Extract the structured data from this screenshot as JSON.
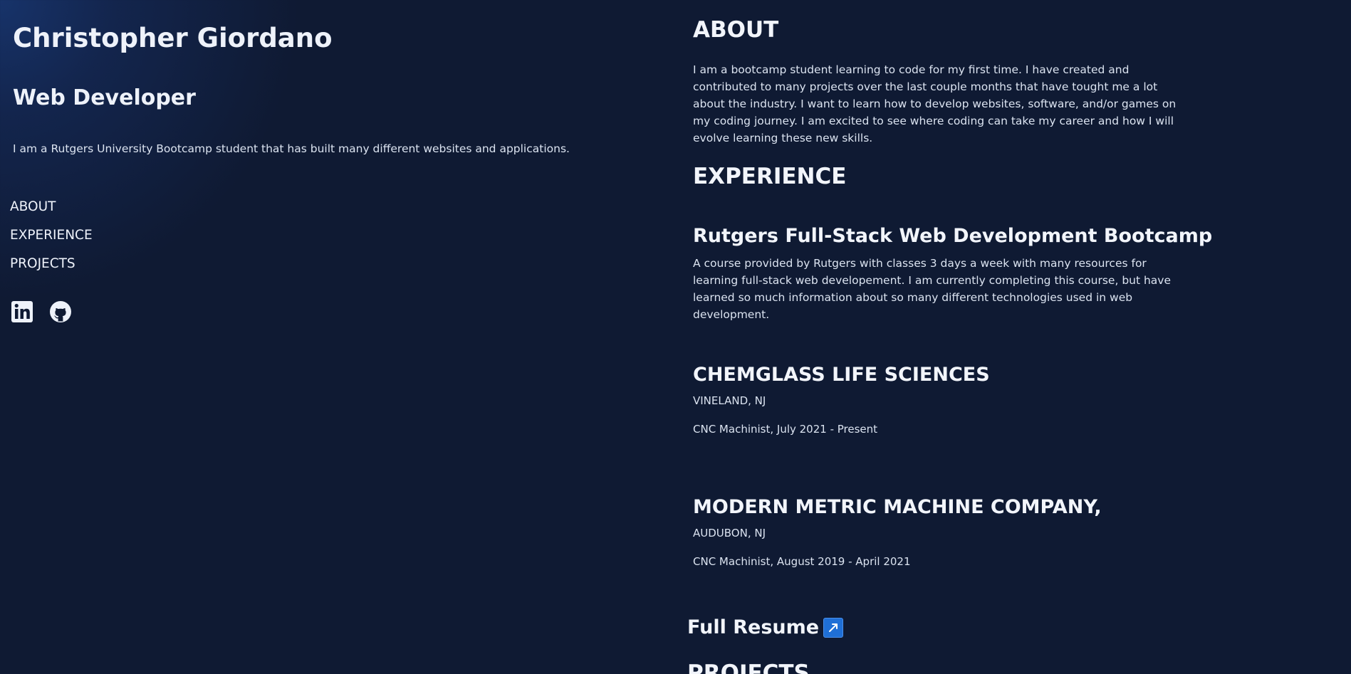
{
  "profile": {
    "name": "Christopher Giordano",
    "role": "Web Developer",
    "intro": "I am a Rutgers University Bootcamp student that has built many different websites and applications."
  },
  "nav": {
    "items": [
      {
        "label": "ABOUT"
      },
      {
        "label": "EXPERIENCE"
      },
      {
        "label": "PROJECTS"
      }
    ]
  },
  "socials": {
    "icons": [
      "linkedin-icon",
      "github-icon"
    ]
  },
  "about": {
    "title": "ABOUT",
    "text": "I am a bootcamp student learning to code for my first time. I have created and contributed to many projects over the last couple months that have tought me a lot about the industry. I want to learn how to develop websites, software, and/or games on my coding journey. I am excited to see where coding can take my career and how I will evolve learning these new skills."
  },
  "experience": {
    "title": "EXPERIENCE",
    "jobs": [
      {
        "title": "Rutgers Full-Stack Web Development Bootcamp",
        "description": "A course provided by Rutgers with classes 3 days a week with many resources for learning full-stack web developement. I am currently completing this course, but have learned so much information about so many different technologies used in web development."
      },
      {
        "title": "CHEMGLASS LIFE SCIENCES",
        "location": "VINELAND, NJ",
        "position": "CNC Machinist, July 2021 - Present"
      },
      {
        "title": "MODERN METRIC MACHINE COMPANY,",
        "location": "AUDUBON, NJ",
        "position": "CNC Machinist, August 2019 - April 2021"
      }
    ],
    "resume_link": "Full Resume"
  },
  "projects": {
    "title": "PROJECTS"
  },
  "colors": {
    "background": "#0f1a33",
    "text": "#e6ecf6",
    "link_icon": "#1f6fd6"
  }
}
